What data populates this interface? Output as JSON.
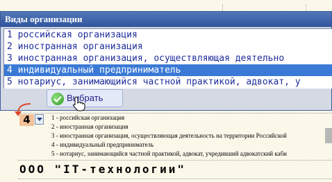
{
  "dialog": {
    "title": "Виды организации",
    "items": [
      {
        "label": "1 российская организация"
      },
      {
        "label": "2 иностранная организация"
      },
      {
        "label": "3 иностранная организация, осуществляющая деятельно"
      },
      {
        "label": "4 индивидуальный предприниматель"
      },
      {
        "label": "5 нотариус, занимающийся частной практикой, адвокат, у"
      }
    ],
    "selected_index": 3,
    "ok_button_label": "Выбрать"
  },
  "document": {
    "selected_code": "4",
    "legend": [
      "1 - российская организация",
      "2 - иностранная организация",
      "3 - иностранная организация, осуществляющая деятельность на территории Российской",
      "4 - индивидуальный предприниматель",
      "5 - нотариус, занимающийся частной практикой, адвокат, учредивший адвокатский каби"
    ],
    "company_name": "ООО \"IT-технологии\""
  },
  "colors": {
    "selection": "#3a7ad6",
    "list_text": "#1f2d9a",
    "code_highlight": "#f3c19a",
    "title_bar": "#2f559d"
  },
  "icons": {
    "ok": "check-circle-icon",
    "dropdown": "triangle-down-icon",
    "cursor": "hand-pointer-icon",
    "annotation": "curved-arrow-icon"
  }
}
